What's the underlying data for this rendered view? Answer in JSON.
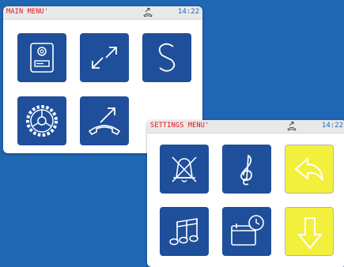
{
  "main_menu": {
    "title": "MAIN MENU'",
    "time": "14:22",
    "status_icon": "call-forward-icon",
    "tiles": [
      "door-station-icon",
      "transfer-arrows-icon",
      "settings-s-icon",
      "gear-wheel-icon",
      "outgoing-call-icon"
    ]
  },
  "settings_menu": {
    "title": "SETTINGS MENU'",
    "time": "14:22",
    "status_icon": "call-forward-icon",
    "tiles": [
      "mute-bell-icon",
      "treble-clef-icon",
      "back-arrow-icon",
      "music-notes-icon",
      "calendar-clock-icon",
      "down-arrow-icon"
    ]
  },
  "colors": {
    "background": "#1f66b3",
    "tile_blue": "#1f4f9a",
    "tile_yellow": "#f3ef3d",
    "title_red": "#e0141b",
    "clock_blue": "#1f66b3"
  }
}
